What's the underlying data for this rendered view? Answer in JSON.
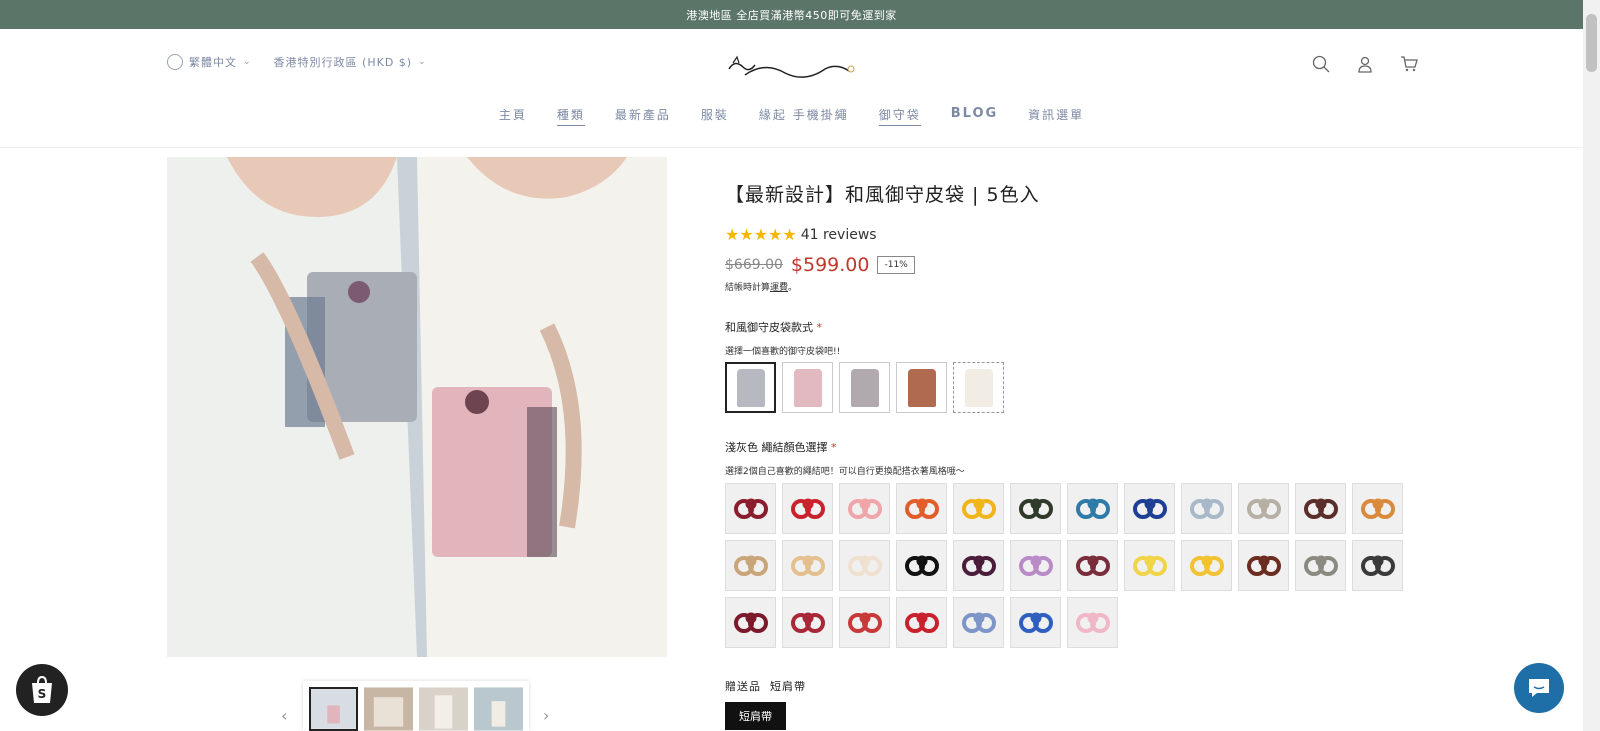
{
  "announcement": "港澳地區 全店買滿港幣450即可免運到家",
  "header": {
    "language": "繁體中文",
    "currency": "香港特別行政區 (HKD $)",
    "icons": [
      "search-icon",
      "account-icon",
      "cart-icon"
    ]
  },
  "nav": [
    {
      "label": "主頁",
      "active": false
    },
    {
      "label": "種類",
      "active": true
    },
    {
      "label": "最新產品",
      "active": false
    },
    {
      "label": "服裝",
      "active": false
    },
    {
      "label": "緣起 手機掛繩",
      "active": false
    },
    {
      "label": "御守袋",
      "active": true
    },
    {
      "label": "BLOG",
      "active": false
    },
    {
      "label": "資訊選單",
      "active": false
    }
  ],
  "product": {
    "title": "【最新設計】和風御守皮袋 | 5色入",
    "stars": "★★★★★",
    "reviews": "41 reviews",
    "old_price": "$669.00",
    "price": "$599.00",
    "discount": "-11%",
    "tax_prefix": "結帳時計算",
    "tax_link": "運費",
    "tax_suffix": "。",
    "option1_label": "和風御守皮袋款式",
    "option1_sub": "選擇一個喜歡的御守皮袋吧!!",
    "bag_colors": [
      "#b7b9c0",
      "#e2b8c1",
      "#b1a9ad",
      "#b06a50",
      "#f1ece4"
    ],
    "option2_label": "淺灰色 繩結顏色選擇",
    "option2_sub": "選擇2個自己喜歡的繩結吧！可以自行更換配搭衣著風格哦～",
    "knot_colors": [
      "#8b1e2e",
      "#c8232c",
      "#f0a5a8",
      "#e35d2b",
      "#f1b51c",
      "#2f3a2a",
      "#2f7ba8",
      "#1f3f95",
      "#a9b8c9",
      "#b5b0a3",
      "#5a2e2a",
      "#d98a3a",
      "#c9a67a",
      "#e4c08e",
      "#efe0cf",
      "#111111",
      "#4a1e3a",
      "#b98bc7",
      "#7a2d3a",
      "#f0d54a",
      "#f2c233",
      "#6b2d20",
      "#8a8a80",
      "#3a3a3a",
      "#7a1a2a",
      "#a8283a",
      "#c83a3a",
      "#c8202c",
      "#7e95c9",
      "#2f60c0",
      "#f1b7c6"
    ],
    "required_mark": "*",
    "gift_label": "贈送品",
    "gift_value": "短肩帶",
    "gift_button": "短肩帶"
  },
  "colors": {
    "accent": "#5b7669",
    "nav": "#7d8aa3",
    "sale": "#c0392b"
  }
}
